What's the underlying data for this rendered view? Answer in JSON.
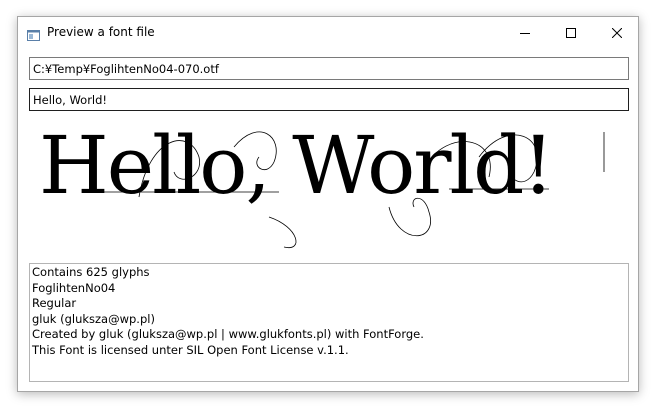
{
  "window": {
    "title": "Preview a font file",
    "icon": "window-app-icon",
    "controls": [
      "minimize-icon",
      "maximize-icon",
      "close-icon"
    ]
  },
  "path_field": {
    "value": "C:¥Temp¥FoglihtenNo04-070.otf"
  },
  "text_field": {
    "value": "Hello, World!"
  },
  "preview": {
    "text": "Hello, World!"
  },
  "info": {
    "lines": [
      "Contains 625 glyphs",
      "FoglihtenNo04",
      "Regular",
      "gluk (gluksza@wp.pl)",
      "Created by gluk (gluksza@wp.pl | www.glukfonts.pl) with FontForge.",
      "This Font is licensed unter SIL Open Font License v.1.1."
    ]
  }
}
